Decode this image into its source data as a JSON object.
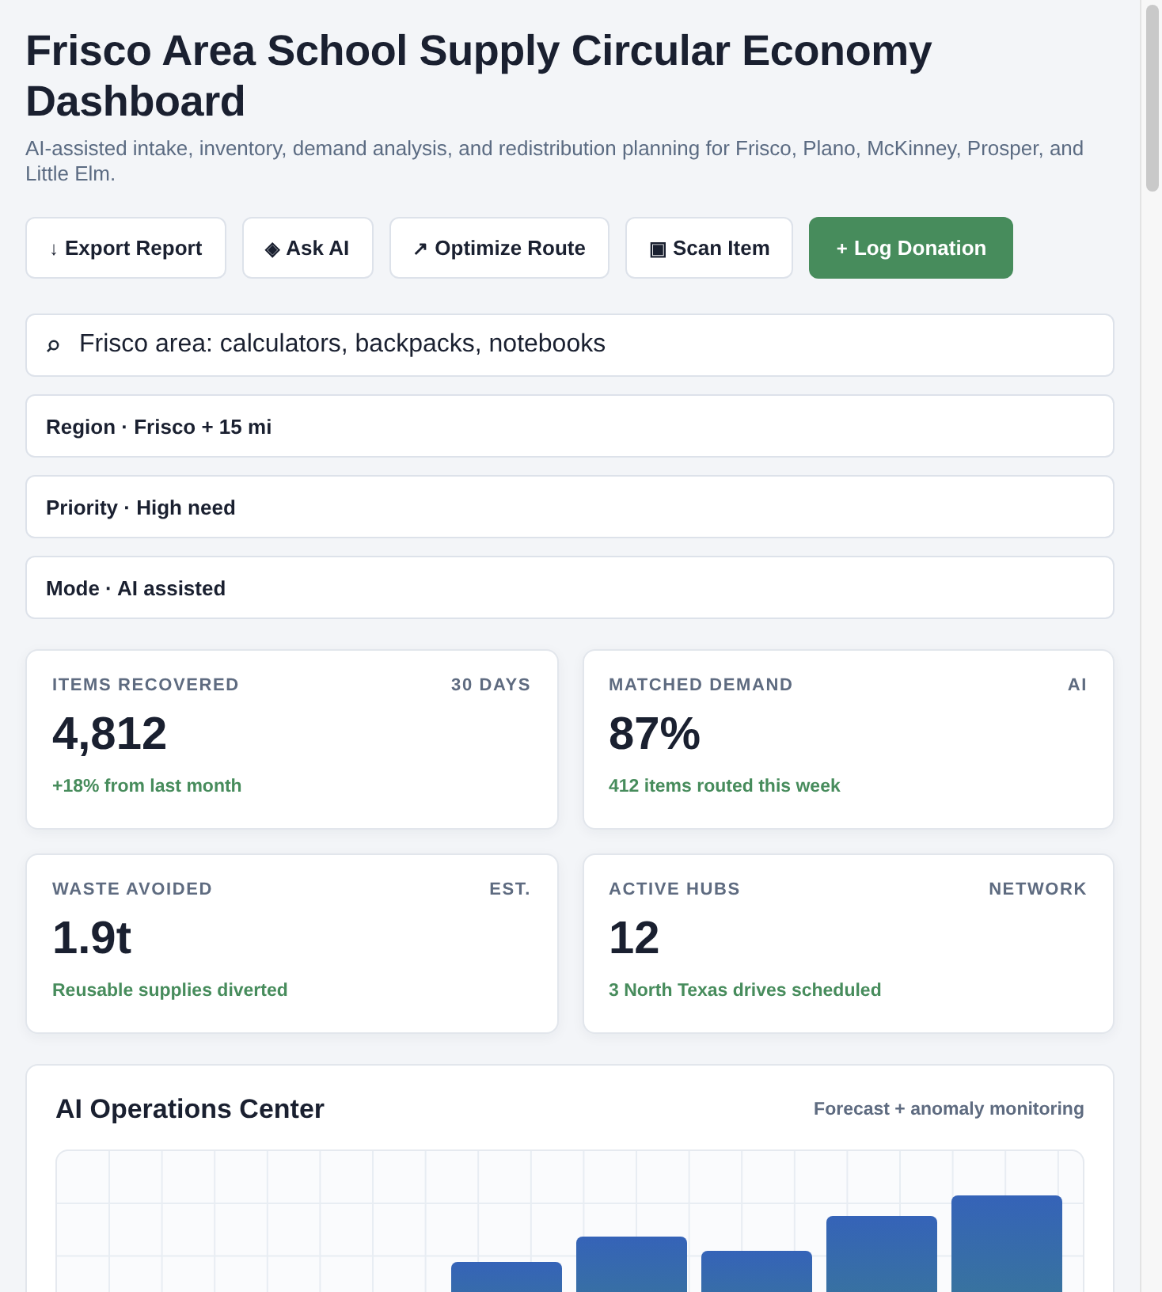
{
  "header": {
    "title": "Frisco Area School Supply Circular Economy Dashboard",
    "subtitle": "AI-assisted intake, inventory, demand analysis, and redistribution planning for Frisco, Plano, McKinney, Prosper, and Little Elm."
  },
  "actions": [
    {
      "icon": "↓",
      "label": "Export Report",
      "kind": "secondary"
    },
    {
      "icon": "◈",
      "label": "Ask AI",
      "kind": "secondary"
    },
    {
      "icon": "↗",
      "label": "Optimize Route",
      "kind": "secondary"
    },
    {
      "icon": "▣",
      "label": "Scan Item",
      "kind": "secondary"
    },
    {
      "icon": "+",
      "label": "Log Donation",
      "kind": "primary"
    }
  ],
  "search": {
    "value": "Frisco area: calculators, backpacks, notebooks"
  },
  "filters": [
    "Region · Frisco + 15 mi",
    "Priority · High need",
    "Mode · AI assisted"
  ],
  "stats": [
    {
      "label": "ITEMS RECOVERED",
      "tag": "30 DAYS",
      "value": "4,812",
      "note": "+18% from last month"
    },
    {
      "label": "MATCHED DEMAND",
      "tag": "AI",
      "value": "87%",
      "note": "412 items routed this week"
    },
    {
      "label": "WASTE AVOIDED",
      "tag": "EST.",
      "value": "1.9t",
      "note": "Reusable supplies diverted"
    },
    {
      "label": "ACTIVE HUBS",
      "tag": "NETWORK",
      "value": "12",
      "note": "3 North Texas drives scheduled"
    }
  ],
  "operations": {
    "title": "AI Operations Center",
    "subtitle": "Forecast + anomaly monitoring"
  }
}
